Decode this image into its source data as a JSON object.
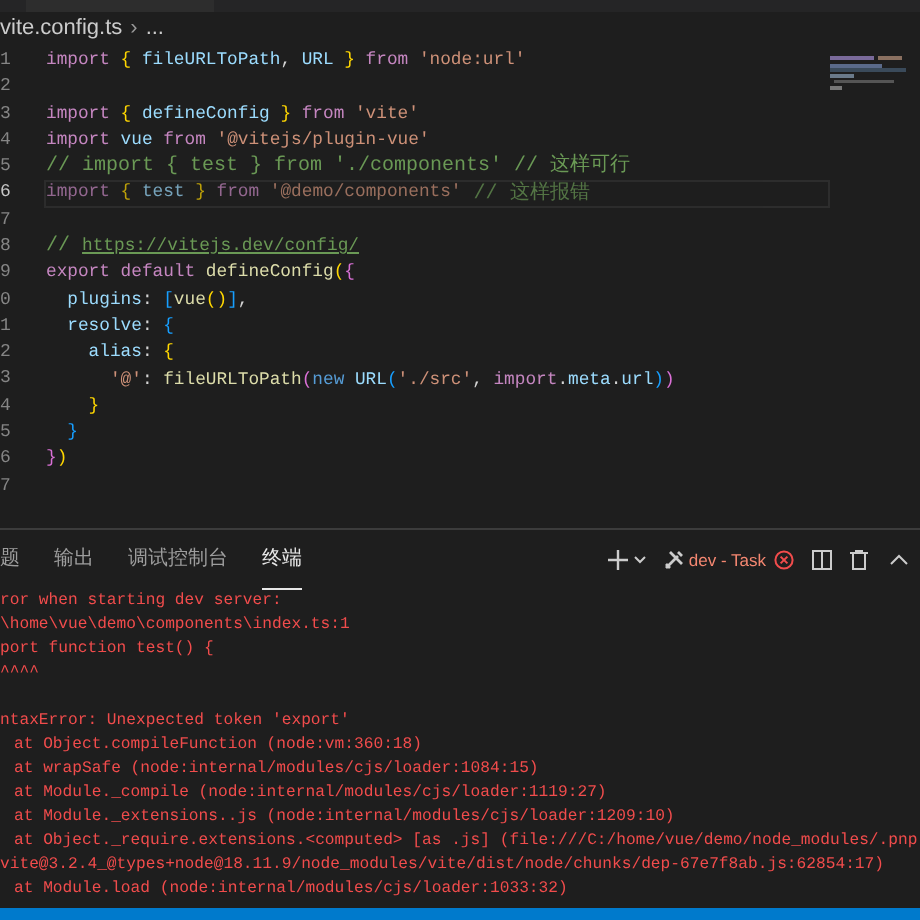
{
  "breadcrumb": {
    "file": "vite.config.ts",
    "separator": "›",
    "rest": "..."
  },
  "code_lines": [
    {
      "number": "1",
      "current": false,
      "tokens": [
        {
          "text": "import",
          "kind": "kw"
        },
        {
          "text": " {",
          "kind": "b1"
        },
        {
          "text": " fileURLToPath",
          "kind": "var"
        },
        {
          "text": ", ",
          "kind": "plain"
        },
        {
          "text": "URL ",
          "kind": "var"
        },
        {
          "text": "}",
          "kind": "b1"
        },
        {
          "text": " from",
          "kind": "kw"
        },
        {
          "text": " 'node:url'",
          "kind": "str"
        }
      ]
    },
    {
      "number": "2",
      "current": false
    },
    {
      "number": "3",
      "current": false,
      "tokens": [
        {
          "text": "import",
          "kind": "kw"
        },
        {
          "text": " {",
          "kind": "b1"
        },
        {
          "text": " defineConfig ",
          "kind": "var"
        },
        {
          "text": "}",
          "kind": "b1"
        },
        {
          "text": " from",
          "kind": "kw"
        },
        {
          "text": " 'vite'",
          "kind": "str"
        }
      ]
    },
    {
      "number": "4",
      "current": false,
      "tokens": [
        {
          "text": "import",
          "kind": "kw"
        },
        {
          "text": " vue",
          "kind": "var"
        },
        {
          "text": " from",
          "kind": "kw"
        },
        {
          "text": " '@vitejs/plugin-vue'",
          "kind": "str"
        }
      ]
    },
    {
      "number": "5",
      "current": false,
      "tokens": [
        {
          "text": "// import { test } from './components' // 这样可行",
          "kind": "com"
        }
      ]
    },
    {
      "number": "6",
      "current": true,
      "tokens": [
        {
          "text": "import",
          "kind": "kw"
        },
        {
          "text": " {",
          "kind": "b1"
        },
        {
          "text": " test ",
          "kind": "var"
        },
        {
          "text": "}",
          "kind": "b1"
        },
        {
          "text": " from",
          "kind": "kw"
        },
        {
          "text": " '@demo/components'",
          "kind": "str"
        },
        {
          "text": " // 这样报错",
          "kind": "com"
        }
      ]
    },
    {
      "number": "7",
      "current": false
    },
    {
      "number": "8",
      "current": false,
      "tokens": [
        {
          "text": "// ",
          "kind": "com"
        },
        {
          "text": "https://vitejs.dev/config/",
          "kind": "link"
        }
      ]
    },
    {
      "number": "9",
      "current": false,
      "tokens": [
        {
          "text": "export",
          "kind": "kw"
        },
        {
          "text": " default",
          "kind": "kw"
        },
        {
          "text": " defineConfig",
          "kind": "fn"
        },
        {
          "text": "(",
          "kind": "b1"
        },
        {
          "text": "{",
          "kind": "b2"
        }
      ]
    },
    {
      "number": "0",
      "current": false,
      "tokens": [
        {
          "text": "  plugins",
          "kind": "var"
        },
        {
          "text": ": ",
          "kind": "plain"
        },
        {
          "text": "[",
          "kind": "b3"
        },
        {
          "text": "vue",
          "kind": "fn"
        },
        {
          "text": "()",
          "kind": "b1"
        },
        {
          "text": "]",
          "kind": "b3"
        },
        {
          "text": ",",
          "kind": "plain"
        }
      ]
    },
    {
      "number": "1",
      "current": false,
      "tokens": [
        {
          "text": "  resolve",
          "kind": "var"
        },
        {
          "text": ": ",
          "kind": "plain"
        },
        {
          "text": "{",
          "kind": "b3"
        }
      ]
    },
    {
      "number": "2",
      "current": false,
      "tokens": [
        {
          "text": "    alias",
          "kind": "var"
        },
        {
          "text": ": ",
          "kind": "plain"
        },
        {
          "text": "{",
          "kind": "b1"
        }
      ]
    },
    {
      "number": "3",
      "current": false,
      "tokens": [
        {
          "text": "      '@'",
          "kind": "str"
        },
        {
          "text": ": ",
          "kind": "plain"
        },
        {
          "text": "fileURLToPath",
          "kind": "fn"
        },
        {
          "text": "(",
          "kind": "b2"
        },
        {
          "text": "new",
          "kind": "new"
        },
        {
          "text": " URL",
          "kind": "var"
        },
        {
          "text": "(",
          "kind": "b3"
        },
        {
          "text": "'./src'",
          "kind": "str"
        },
        {
          "text": ", ",
          "kind": "plain"
        },
        {
          "text": "import",
          "kind": "kw"
        },
        {
          "text": ".",
          "kind": "plain"
        },
        {
          "text": "meta",
          "kind": "var"
        },
        {
          "text": ".",
          "kind": "plain"
        },
        {
          "text": "url",
          "kind": "var"
        },
        {
          "text": ")",
          "kind": "b3"
        },
        {
          "text": ")",
          "kind": "b2"
        }
      ]
    },
    {
      "number": "4",
      "current": false,
      "tokens": [
        {
          "text": "    }",
          "kind": "b1"
        }
      ]
    },
    {
      "number": "5",
      "current": false,
      "tokens": [
        {
          "text": "  }",
          "kind": "b3"
        }
      ]
    },
    {
      "number": "6",
      "current": false,
      "tokens": [
        {
          "text": "}",
          "kind": "b2"
        },
        {
          "text": ")",
          "kind": "b1"
        }
      ]
    },
    {
      "number": "7",
      "current": false
    }
  ],
  "panel": {
    "tabs": [
      {
        "label": "题",
        "selected": false
      },
      {
        "label": "输出",
        "selected": false
      },
      {
        "label": "调试控制台",
        "selected": false
      },
      {
        "label": "终端",
        "selected": true
      }
    ],
    "task": {
      "label": "dev - Task"
    },
    "terminal_lines": [
      {
        "kind": "flush",
        "text": "ror when starting dev server:"
      },
      {
        "kind": "flush",
        "text": "\\home\\vue\\demo\\components\\index.ts:1"
      },
      {
        "kind": "flush",
        "text": "port function test() {"
      },
      {
        "kind": "flush",
        "text": "^^^^"
      },
      {
        "kind": "blank"
      },
      {
        "kind": "flush",
        "text": "ntaxError: Unexpected token 'export'"
      },
      {
        "kind": "stack",
        "text": "at Object.compileFunction (node:vm:360:18)"
      },
      {
        "kind": "stack",
        "text": "at wrapSafe (node:internal/modules/cjs/loader:1084:15)"
      },
      {
        "kind": "stack",
        "text": "at Module._compile (node:internal/modules/cjs/loader:1119:27)"
      },
      {
        "kind": "stack",
        "text": "at Module._extensions..js (node:internal/modules/cjs/loader:1209:10)"
      },
      {
        "kind": "stack",
        "text": "at Object._require.extensions.<computed> [as .js] (file:///C:/home/vue/demo/node_modules/.pnp"
      },
      {
        "kind": "flush",
        "text": "vite@3.2.4_@types+node@18.11.9/node_modules/vite/dist/node/chunks/dep-67e7f8ab.js:62854:17)"
      },
      {
        "kind": "stack",
        "text": "at Module.load (node:internal/modules/cjs/loader:1033:32)"
      }
    ]
  }
}
